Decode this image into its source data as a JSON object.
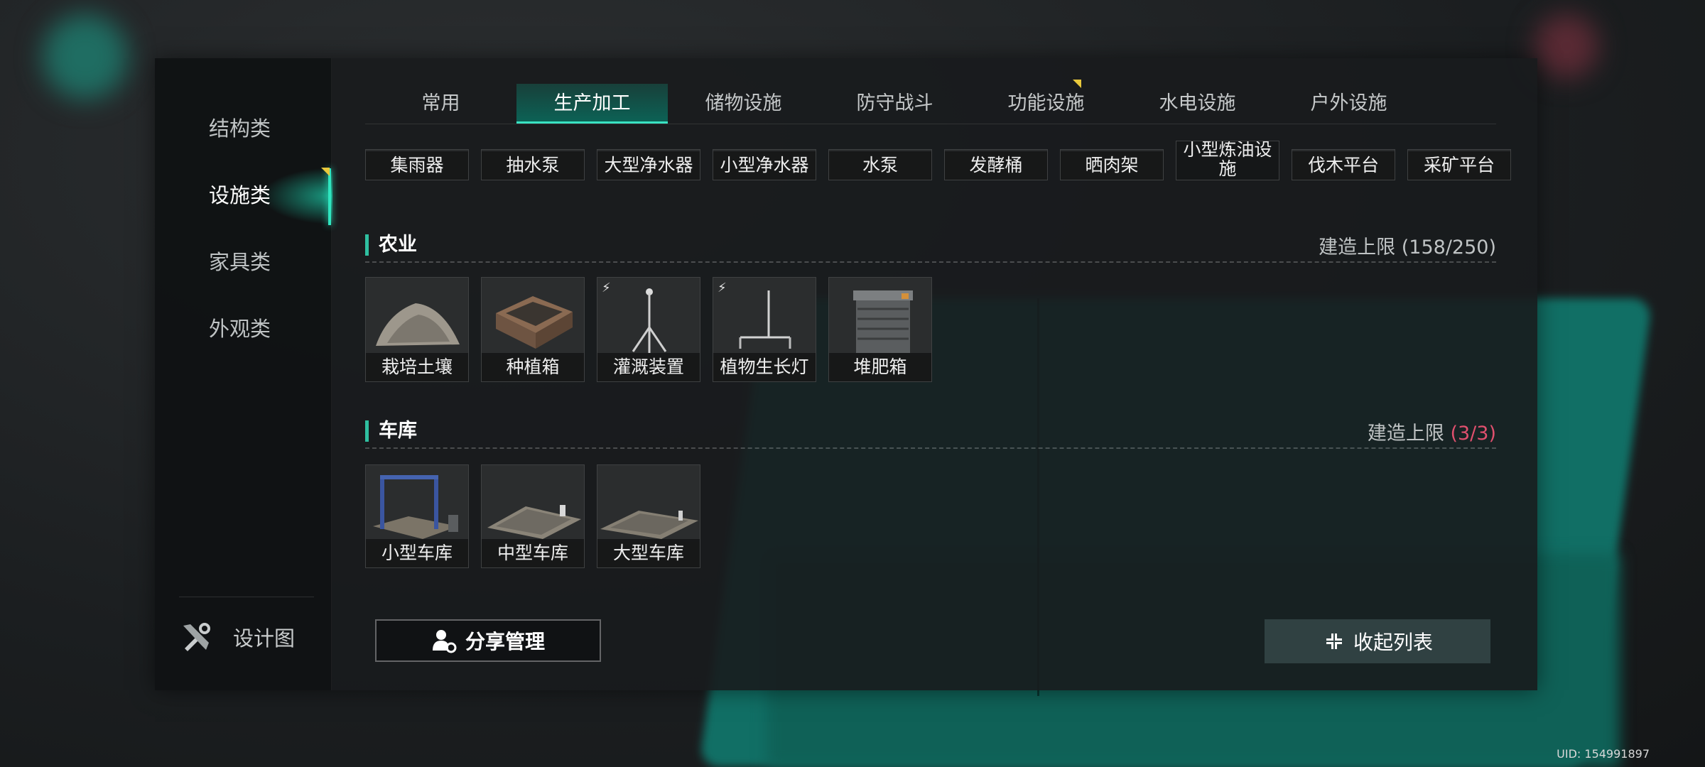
{
  "categories": [
    {
      "label": "结构类",
      "active": false
    },
    {
      "label": "设施类",
      "active": true
    },
    {
      "label": "家具类",
      "active": false
    },
    {
      "label": "外观类",
      "active": false
    }
  ],
  "design_label": "设计图",
  "tabs": [
    {
      "label": "常用",
      "active": false
    },
    {
      "label": "生产加工",
      "active": true
    },
    {
      "label": "储物设施",
      "active": false
    },
    {
      "label": "防守战斗",
      "active": false
    },
    {
      "label": "功能设施",
      "active": false
    },
    {
      "label": "水电设施",
      "active": false
    },
    {
      "label": "户外设施",
      "active": false
    }
  ],
  "top_row": [
    "集雨器",
    "抽水泵",
    "大型净水器",
    "小型净水器",
    "水泵",
    "发酵桶",
    "晒肉架",
    "小型炼油设施",
    "伐木平台",
    "采矿平台"
  ],
  "agriculture": {
    "title": "农业",
    "limit_label": "建造上限",
    "limit_value": "(158/250)",
    "items": [
      {
        "name": "栽培土壤",
        "powered": false,
        "icon": "soil-pile-icon"
      },
      {
        "name": "种植箱",
        "powered": false,
        "icon": "planter-box-icon"
      },
      {
        "name": "灌溉装置",
        "powered": true,
        "icon": "sprinkler-icon"
      },
      {
        "name": "植物生长灯",
        "powered": true,
        "icon": "grow-lamp-icon"
      },
      {
        "name": "堆肥箱",
        "powered": false,
        "icon": "compost-bin-icon"
      }
    ]
  },
  "garage": {
    "title": "车库",
    "limit_label": "建造上限",
    "limit_value": "(3/3)",
    "items": [
      {
        "name": "小型车库",
        "icon": "car-lift-icon"
      },
      {
        "name": "中型车库",
        "icon": "garage-pad-icon"
      },
      {
        "name": "大型车库",
        "icon": "garage-pad-large-icon"
      }
    ]
  },
  "share_button": "分享管理",
  "collapse_button": "收起列表",
  "uid": "UID: 154991897",
  "colors": {
    "accent": "#2fe6c0",
    "limit_full": "#e0506e",
    "new_marker": "#e8c83c"
  }
}
